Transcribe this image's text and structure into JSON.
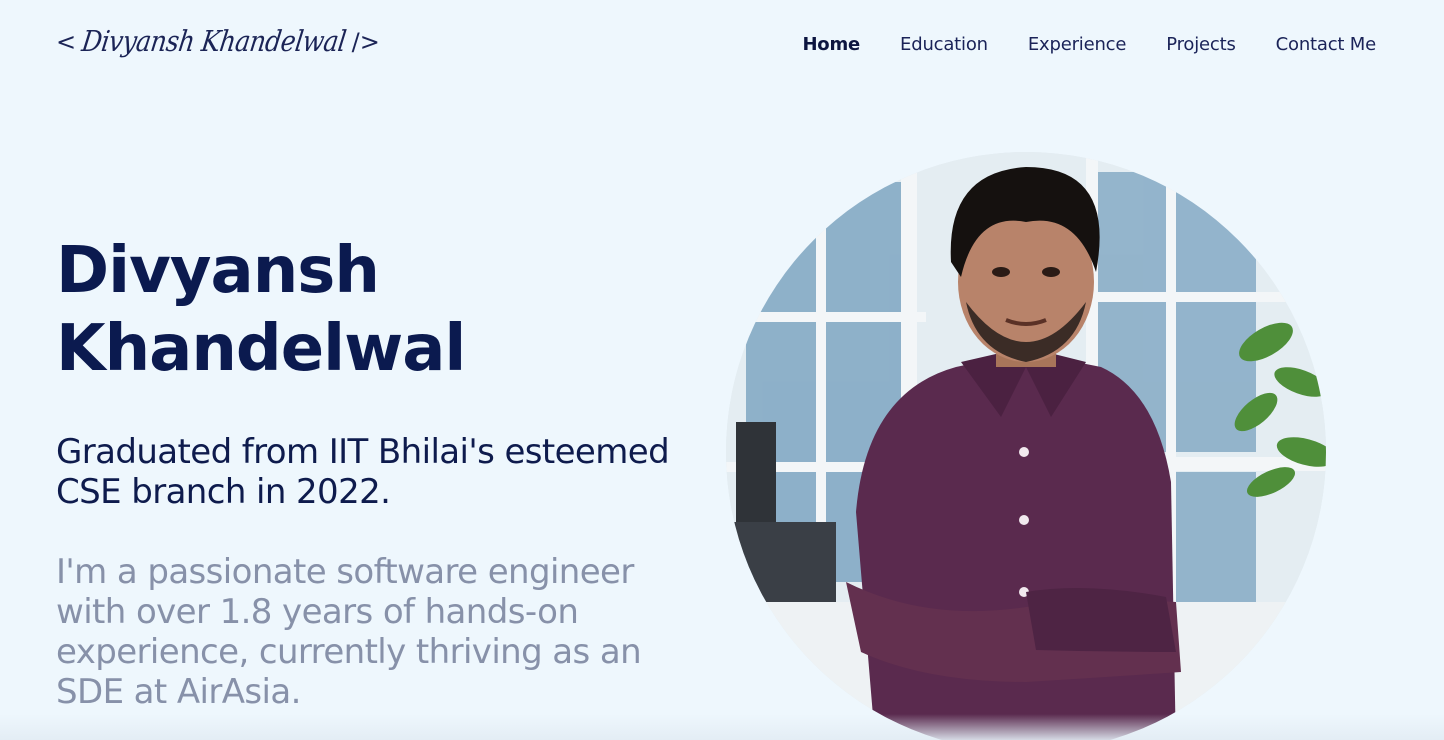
{
  "header": {
    "logo": {
      "open_bracket": "<",
      "signature": "Divyansh Khandelwal",
      "close_bracket": "/>"
    },
    "nav": [
      {
        "label": "Home",
        "active": true
      },
      {
        "label": "Education",
        "active": false
      },
      {
        "label": "Experience",
        "active": false
      },
      {
        "label": "Projects",
        "active": false
      },
      {
        "label": "Contact Me",
        "active": false
      }
    ]
  },
  "hero": {
    "name_line1": "Divyansh",
    "name_line2": "Khandelwal",
    "subtitle": "Graduated from IIT Bhilai's esteemed CSE branch in 2022.",
    "description": "I'm a passionate software engineer with over 1.8 years of hands-on experience, currently thriving as an SDE at AirAsia."
  },
  "portrait": {
    "icon": "profile-photo"
  },
  "colors": {
    "background": "#eef7fd",
    "heading": "#0b1a4f",
    "muted": "#8791a9",
    "shirt": "#5a2a4e"
  }
}
